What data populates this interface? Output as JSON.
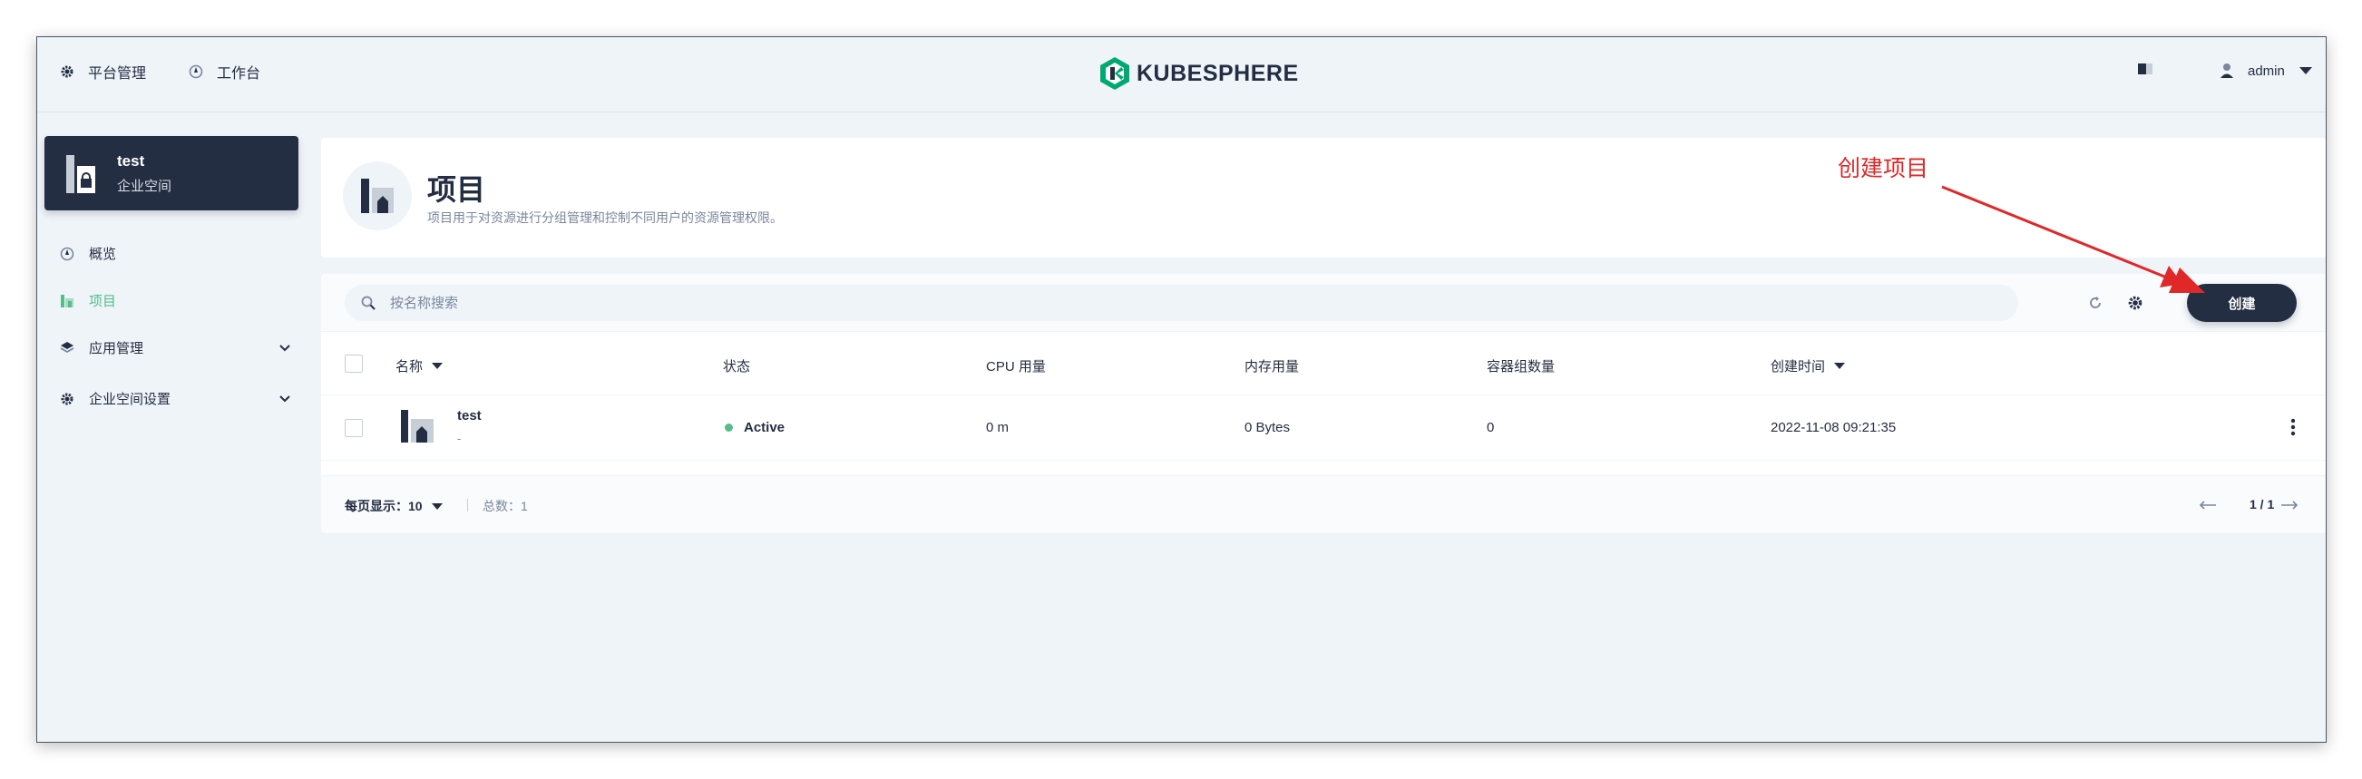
{
  "topbar": {
    "platform_label": "平台管理",
    "workbench_label": "工作台",
    "logo_text": "KUBESPHERE",
    "user_name": "admin"
  },
  "workspace": {
    "name": "test",
    "subtitle": "企业空间"
  },
  "sidebar": {
    "items": [
      {
        "label": "概览",
        "icon": "dashboard-icon"
      },
      {
        "label": "项目",
        "icon": "project-icon",
        "active": true
      },
      {
        "label": "应用管理",
        "icon": "layers-icon"
      },
      {
        "label": "企业空间设置",
        "icon": "gear-icon"
      }
    ]
  },
  "banner": {
    "title": "项目",
    "description": "项目用于对资源进行分组管理和控制不同用户的资源管理权限。"
  },
  "annotation": {
    "text": "创建项目",
    "color": "#e02828"
  },
  "toolbar": {
    "search_placeholder": "按名称搜索",
    "create_label": "创建"
  },
  "table": {
    "columns": [
      "名称",
      "状态",
      "CPU 用量",
      "内存用量",
      "容器组数量",
      "创建时间"
    ],
    "rows": [
      {
        "name": "test",
        "description": "-",
        "status": "Active",
        "cpu": "0 m",
        "memory": "0 Bytes",
        "pods": "0",
        "created": "2022-11-08 09:21:35"
      }
    ]
  },
  "pagination": {
    "page_size_label": "每页显示：",
    "page_size": "10",
    "total_label": "总数：",
    "total": "1",
    "page_indicator": "1 / 1"
  },
  "colors": {
    "accent": "#55bc8a",
    "dark": "#242e42",
    "background": "#eff4f9"
  }
}
